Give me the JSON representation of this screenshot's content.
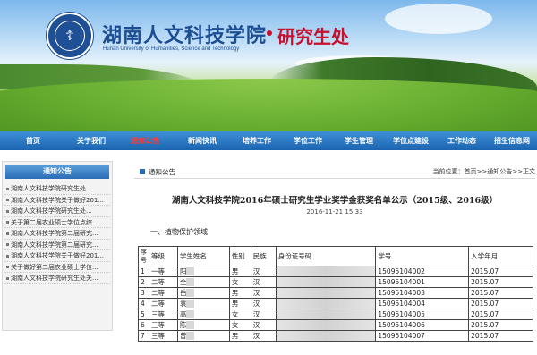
{
  "banner": {
    "school_name_cn": "湖南人文科技学院",
    "school_name_en": "Hunan University of Humanities, Science and Technology",
    "department": "研究生处",
    "logo_glyph": "☦",
    "colors": {
      "school_blue": "#1c4d92",
      "dept_red": "#c8102e"
    }
  },
  "nav": {
    "items": [
      {
        "label": "首页",
        "active": false
      },
      {
        "label": "关于我们",
        "active": false
      },
      {
        "label": "通知公告",
        "active": true
      },
      {
        "label": "新闻快讯",
        "active": false
      },
      {
        "label": "培养工作",
        "active": false
      },
      {
        "label": "学位工作",
        "active": false
      },
      {
        "label": "学生管理",
        "active": false
      },
      {
        "label": "学位点建设",
        "active": false
      },
      {
        "label": "工作动态",
        "active": false
      },
      {
        "label": "招生信息网",
        "active": false
      }
    ],
    "colors": {
      "bar": "#1c64b0",
      "active_text": "#ff3b2f"
    }
  },
  "sidebar": {
    "title": "通知公告",
    "items": [
      "湖南人文科技学院研究生处...",
      "湖南人文科技学院关于做好201...",
      "湖南人文科技学院研究生处...",
      "关于第二届农业硕士学位点综...",
      "湖南人文科技学院第二届研究...",
      "湖南人文科技学院第二届研究...",
      "湖南人文科技学院关于做好201...",
      "关于做好第二届农业硕士学位...",
      "湖南人文科技学院研究生处关..."
    ]
  },
  "main": {
    "section_title": "通知公告",
    "breadcrumb": {
      "prefix": "当前位置：",
      "path": "首页>>通知公告>>正文"
    },
    "article": {
      "title": "湖南人文科技学院2016年硕士研究生学业奖学金获奖名单公示（2015级、2016级）",
      "date": "2016-11-21 15:33",
      "section": "一、植物保护领域"
    },
    "table": {
      "headers": [
        "序号",
        "等级",
        "学生姓名",
        "性别",
        "民族",
        "身份证号码",
        "学号",
        "入学年月"
      ],
      "rows": [
        [
          "1",
          "一等",
          "阳",
          "男",
          "汉",
          "",
          "15095104002",
          "2015.07"
        ],
        [
          "2",
          "二等",
          "全",
          "女",
          "汉",
          "",
          "15095104001",
          "2015.07"
        ],
        [
          "3",
          "二等",
          "岳",
          "男",
          "汉",
          "",
          "15095104003",
          "2015.07"
        ],
        [
          "4",
          "二等",
          "袁",
          "男",
          "汉",
          "",
          "15095104004",
          "2015.07"
        ],
        [
          "5",
          "三等",
          "高",
          "女",
          "汉",
          "",
          "15095104005",
          "2015.07"
        ],
        [
          "6",
          "三等",
          "陈",
          "女",
          "汉",
          "",
          "15095104006",
          "2015.07"
        ],
        [
          "7",
          "三等",
          "曾",
          "男",
          "汉",
          "",
          "15095104007",
          "2015.07"
        ]
      ]
    }
  }
}
